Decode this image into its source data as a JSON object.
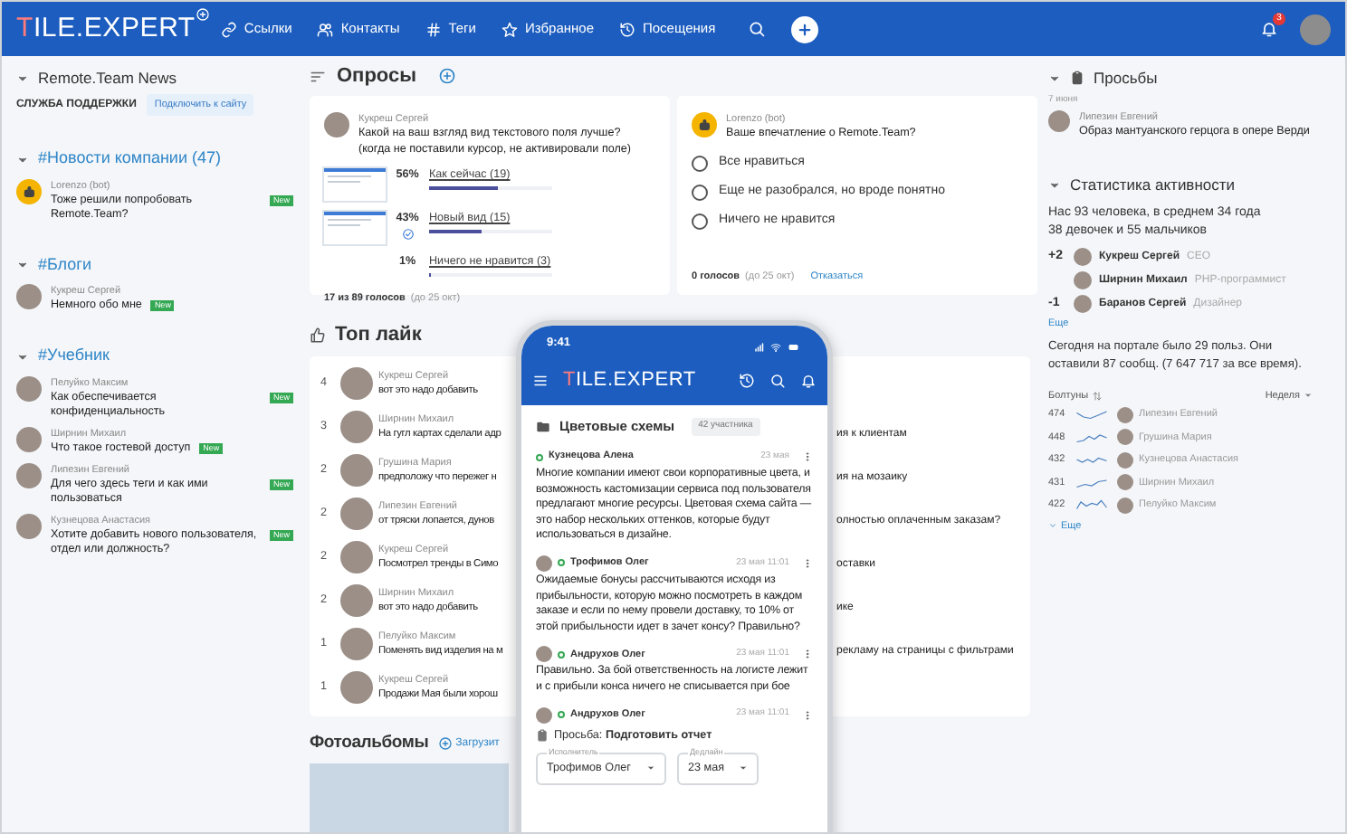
{
  "header": {
    "logo": "TILE.EXPERT",
    "nav": [
      {
        "kind": "link",
        "label": "Ссылки"
      },
      {
        "kind": "contacts",
        "label": "Контакты"
      },
      {
        "kind": "tag",
        "label": "Теги"
      },
      {
        "kind": "star",
        "label": "Избранное"
      },
      {
        "kind": "history",
        "label": "Посещения"
      }
    ],
    "notifications": "3"
  },
  "left": {
    "channel": "Remote.Team News",
    "support": {
      "label": "СЛУЖБА ПОДДЕРЖКИ",
      "button": "Подключить к сайту"
    },
    "sections": [
      {
        "title": "#Новости компании (47)",
        "expanded": true,
        "items": [
          {
            "kind": "bot",
            "author": "Lorenzo (bot)",
            "text": "Тоже решили попробовать Remote.Team?",
            "badge": "New"
          }
        ]
      },
      {
        "title": "#Блоги",
        "expanded": true,
        "items": [
          {
            "kind": "person",
            "author": "Кукреш Сергей",
            "text": "Немного обо мне",
            "badge": "New"
          }
        ]
      },
      {
        "title": "#Учебник",
        "expanded": true,
        "items": [
          {
            "kind": "person",
            "author": "Пелуйко Максим",
            "text": "Как обеспечивается конфиденциальность",
            "badge": "New"
          },
          {
            "kind": "person",
            "author": "Ширнин Михаил",
            "text": "Что такое гостевой доступ",
            "badge": "New"
          },
          {
            "kind": "person",
            "author": "Липезин Евгений",
            "text": "Для чего здесь теги и как ими пользоваться",
            "badge": "New"
          },
          {
            "kind": "person",
            "author": "Кузнецова Анастасия",
            "text": "Хотите добавить нового пользователя, отдел или должность?",
            "badge": "New"
          }
        ]
      }
    ]
  },
  "polls": {
    "title": "Опросы",
    "items": [
      {
        "kind": "results",
        "author": {
          "kind": "person",
          "name": "Кукреш Сергей"
        },
        "question": "Какой на ваш взгляд вид текстового поля лучше? (когда не поставили курсор, не активировали поле)",
        "options": [
          {
            "thumbnail": true,
            "voted": false,
            "percent": "56%",
            "label": "Как сейчас (19)",
            "level": 0.56
          },
          {
            "thumbnail": true,
            "voted": true,
            "percent": "43%",
            "label": "Новый вид (15)",
            "level": 0.43
          },
          {
            "thumbnail": false,
            "voted": false,
            "percent": "1%",
            "label": "Ничего не нравится (3)",
            "level": 0.01
          }
        ],
        "votes": "17 из 89 голосов",
        "deadline": "(до 25 окт)"
      },
      {
        "kind": "vote",
        "author": {
          "kind": "bot",
          "name": "Lorenzo (bot)"
        },
        "question": "Ваше впечатление о Remote.Team?",
        "options": [
          {
            "label": "Все нравиться",
            "selected": false
          },
          {
            "label": "Еще не разобрался, но вроде понятно",
            "selected": false
          },
          {
            "label": "Ничего не нравится",
            "selected": false
          }
        ],
        "votes": "0 голосов",
        "deadline": "(до 25 окт)",
        "action": "Отказаться"
      }
    ]
  },
  "top_likes": {
    "title": "Топ лайк",
    "rows": [
      {
        "count": "4",
        "author": "Кукреш Сергей",
        "text": "вот это надо добавить"
      },
      {
        "count": "3",
        "author": "Ширнин Михаил",
        "text": "На гугл картах сделали адр",
        "tail": "ия к клиентам"
      },
      {
        "count": "2",
        "author": "Грушина Мария",
        "text": "предположу что пережег н",
        "tail": "ия на мозаику"
      },
      {
        "count": "2",
        "author": "Липезин Евгений",
        "text": "от тряски лопается, дунов",
        "tail": "олностью оплаченным заказам?"
      },
      {
        "count": "2",
        "author": "Кукреш Сергей",
        "text": "Посмотрел тренды в Симо",
        "tail": "оставки"
      },
      {
        "count": "2",
        "author": "Ширнин Михаил",
        "text": "вот это надо добавить",
        "tail": "ике"
      },
      {
        "count": "1",
        "author": "Пелуйко Максим",
        "text": "Поменять вид изделия на м",
        "tail": "рекламу на страницы с фильтрами"
      },
      {
        "count": "1",
        "author": "Кукреш Сергей",
        "text": "Продажи Мая были хорош"
      }
    ]
  },
  "albums": {
    "title": "Фотоальбомы",
    "upload": "Загрузит"
  },
  "requests": {
    "title": "Просьбы",
    "expanded": true,
    "date": "7 июня",
    "author": "Липезин Евгений",
    "text": "Образ мантуанского герцога в опере Верди"
  },
  "stats": {
    "title": "Статистика активности",
    "expanded": true,
    "summary": [
      "Нас 93 человека, в среднем 34 года",
      "38 девочек и 55 мальчиков"
    ],
    "people": [
      {
        "delta": "+2",
        "name": "Кукреш Сергей",
        "role": "CEO"
      },
      {
        "name": "Ширнин Михаил",
        "role": "PHP-программист"
      },
      {
        "delta": "-1",
        "name": "Баранов Сергей",
        "role": "Дизайнер"
      }
    ],
    "more": "Еще",
    "today": "Сегодня на портале было 29 польз. Они оставили 87 сообщ. (7 647 717 за все время).",
    "chatters": {
      "label": "Болтуны",
      "period": "Неделя",
      "rows": [
        {
          "count": "474",
          "name": "Липезин Евгений"
        },
        {
          "count": "448",
          "name": "Грушина Мария"
        },
        {
          "count": "432",
          "name": "Кузнецова Анастасия"
        },
        {
          "count": "431",
          "name": "Ширнин Михаил"
        },
        {
          "count": "422",
          "name": "Пелуйко Максим"
        }
      ],
      "more": "Еще"
    }
  },
  "phone": {
    "time": "9:41",
    "logo": "TILE.EXPERT",
    "chat": {
      "title": "Цветовые схемы",
      "members": "42 участника"
    },
    "messages": [
      {
        "kind": "text",
        "avatar": false,
        "online": true,
        "author": "Кузнецова Алена",
        "time": "23 мая",
        "text": "Многие компании имеют свои корпоративные цвета, и возможность кастомизации сервиса под пользователя предлагают многие ресурсы. Цветовая схема сайта — это набор нескольких оттенков, которые будут использоваться в дизайне."
      },
      {
        "kind": "text",
        "avatar": true,
        "online": true,
        "author": "Трофимов Олег",
        "time": "23 мая 11:01",
        "text": "Ожидаемые бонусы рассчитываются исходя из прибыльности, которую можно посмотреть в каждом заказе и если по нему провели доставку, то 10% от этой прибыльности идет в зачет консу? Правильно?"
      },
      {
        "kind": "text",
        "avatar": true,
        "online": true,
        "author": "Андрухов Олег",
        "time": "23 мая 11:01",
        "text": "Правильно. За бой ответственность на логисте лежит и с прибыли конса ничего не списывается при бое"
      },
      {
        "kind": "task",
        "avatar": true,
        "online": true,
        "author": "Андрухов Олег",
        "time": "23 мая 11:01",
        "text": "Просьба: **Подготовить отчет**",
        "fields": [
          {
            "label": "Исполнитель",
            "value": "Трофимов Олег"
          },
          {
            "label": "Дедлайн",
            "value": "23 мая"
          }
        ]
      }
    ]
  }
}
